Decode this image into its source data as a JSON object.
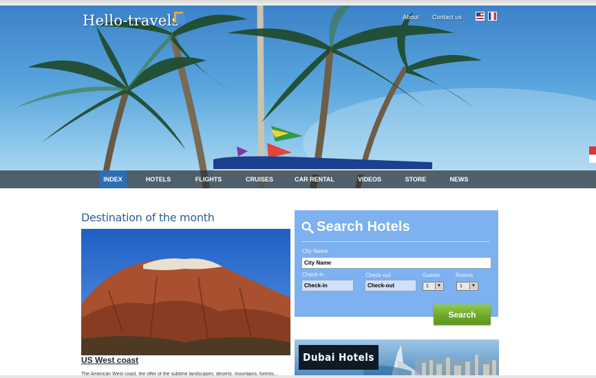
{
  "site": {
    "logo": "Hello-travels",
    "top_links": [
      "About",
      "Contact us"
    ]
  },
  "nav": {
    "items": [
      "INDEX",
      "HOTELS",
      "FLIGHTS",
      "CRUISES",
      "CAR RENTAL",
      "VIDEOS",
      "STORE",
      "NEWS"
    ],
    "active": "INDEX"
  },
  "destination": {
    "heading": "Destination of the month",
    "caption": "US West coast",
    "text": "The American West coast, the offer of the sublime landscapes, deserts, mountains, forests..."
  },
  "search": {
    "title": "Search Hotels",
    "city_label": "City Name",
    "city_value": "City Name",
    "checkin_label": "Check-in",
    "checkin_value": "Check-in",
    "checkout_label": "Check-out",
    "checkout_value": "Check-out",
    "guests_label": "Guests",
    "guests_value": "1",
    "rooms_label": "Rooms",
    "rooms_value": "1",
    "button": "Search"
  },
  "banner": {
    "title": "Dubai Hotels"
  },
  "colors": {
    "search_panel": "#7eb1ef",
    "nav_active": "#2f6db3",
    "search_button": "#6ea82a"
  }
}
